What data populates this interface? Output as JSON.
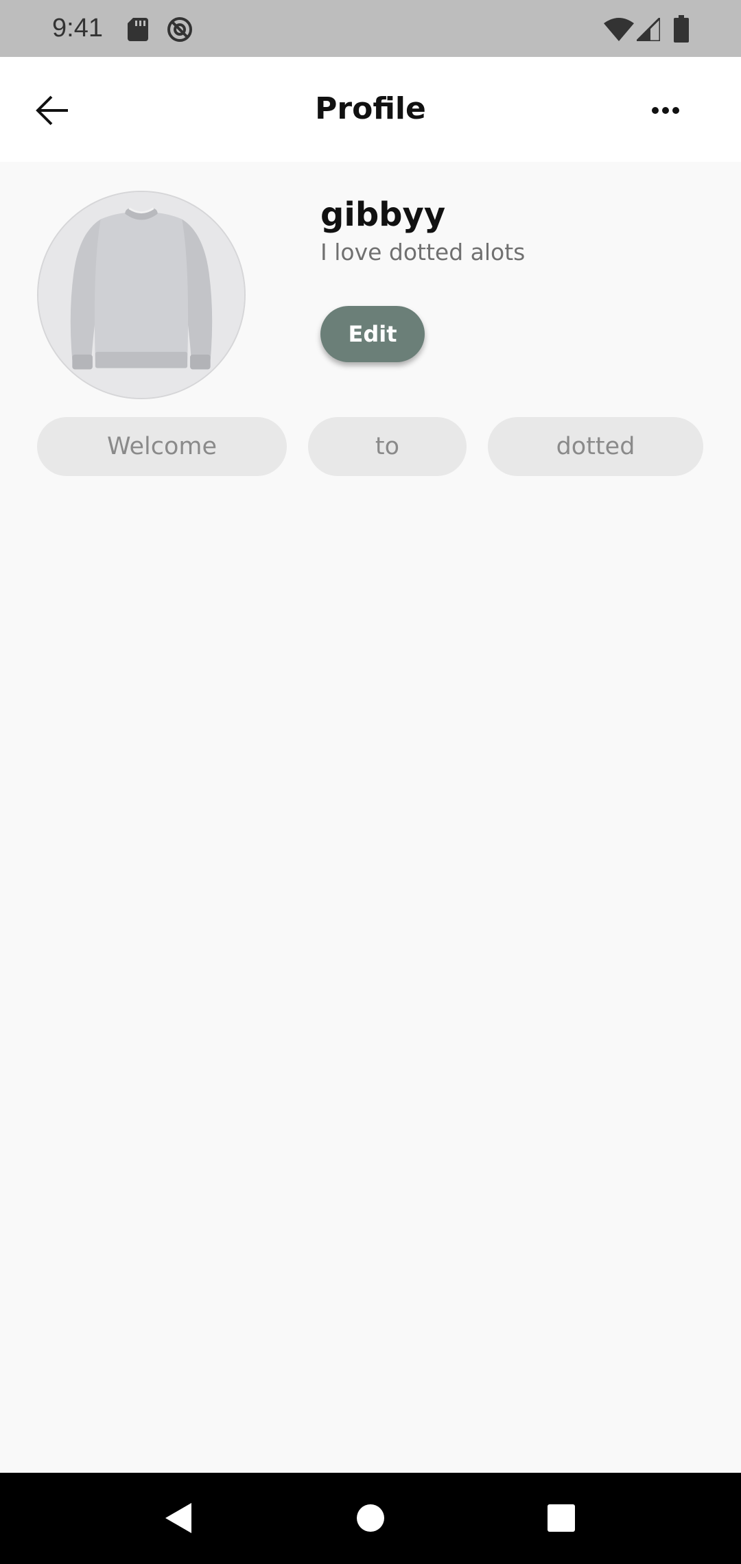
{
  "status_bar": {
    "time": "9:41",
    "icons": [
      "sd-card-icon",
      "do-not-disturb-icon",
      "wifi-icon",
      "cell-signal-icon",
      "battery-icon"
    ]
  },
  "app_bar": {
    "title": "Profile",
    "back_icon": "arrow-left-icon",
    "more_icon": "more-horizontal-icon"
  },
  "profile": {
    "avatar_icon": "sweater-photo",
    "username": "gibbyy",
    "bio": "I love dotted alots",
    "edit_label": "Edit"
  },
  "chips": [
    {
      "label": "Welcome"
    },
    {
      "label": "to"
    },
    {
      "label": "dotted"
    }
  ],
  "nav_bar": {
    "icons": [
      "nav-back-icon",
      "nav-home-icon",
      "nav-recents-icon"
    ]
  },
  "colors": {
    "status_bar_bg": "#bdbdbd",
    "app_bar_bg": "#ffffff",
    "page_bg": "#f9f9f9",
    "edit_button_bg": "#6b7f78",
    "chip_bg": "#e8e8e8",
    "chip_text": "#8a8a8a",
    "nav_bar_bg": "#000000"
  }
}
